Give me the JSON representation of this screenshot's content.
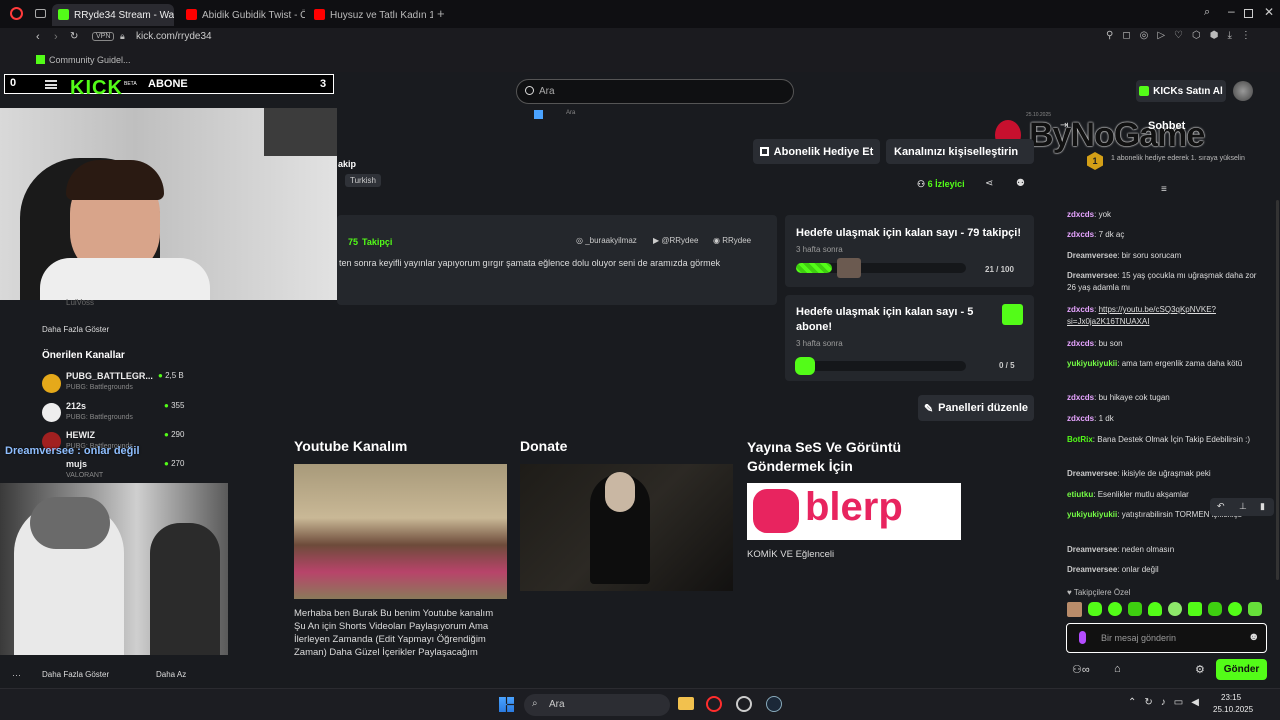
{
  "browser": {
    "tabs": [
      {
        "label": "RRyde34 Stream - Watch",
        "color": "#53fc18"
      },
      {
        "label": "Abidik Gubidik Twist - Öz",
        "color": "#ff0000"
      },
      {
        "label": "Huysuz ve Tatlı Kadın 1. B",
        "color": "#ff0000"
      }
    ],
    "vpn": "VPN",
    "url": "kick.com/rryde34",
    "bookmark": "Community Guidel..."
  },
  "overlay": {
    "left_number": "0",
    "logo": "KICK",
    "beta": "BETA",
    "abone_label": "ABONE",
    "abone_count": "3",
    "brand": "ByNoGame"
  },
  "header": {
    "search_placeholder": "Ara",
    "buy_kicks": "KICKs Satın Al"
  },
  "stream_preview": {
    "search": "Ara",
    "date": "25.10.2025"
  },
  "channel": {
    "follow_partial": "akip",
    "language": "Turkish",
    "gift_sub": "Abonelik Hediye Et",
    "customize": "Kanalınızı kişiselleştirin",
    "viewers_count": "6",
    "viewers_label": "İzleyici",
    "followers_count": "75",
    "followers_label": "Takipçi",
    "socials": [
      "_buraakyilmaz",
      "@RRydee",
      "RRydee"
    ],
    "bio": "ten sonra keyifli yayınlar yapıyorum gırgır şamata eğlence dolu oluyor seni de aramızda görmek"
  },
  "goals": [
    {
      "title": "Hedefe ulaşmak için kalan sayı - 79 takipçi!",
      "time": "3 hafta sonra",
      "progress": "21 / 100",
      "fraction": 0.21
    },
    {
      "title": "Hedefe ulaşmak için kalan sayı - 5 abone!",
      "time": "3 hafta sonra",
      "progress": "0 / 5",
      "fraction": 0
    }
  ],
  "edit_panels": "Panelleri düzenle",
  "panels": [
    {
      "title": "Youtube Kanalım",
      "text": "Merhaba ben Burak Bu benim Youtube kanalım Şu An için Shorts Videoları Paylaşıyorum Ama İlerleyen Zamanda (Edit Yapmayı Öğrendiğim Zaman) Daha Güzel İçerikler Paylaşacağım"
    },
    {
      "title": "Donate",
      "text": ""
    },
    {
      "title": "Yayına SeS Ve Görüntü Göndermek İçin",
      "text": "KOMİK VE Eğlenceli",
      "image_text": "blerp"
    }
  ],
  "sidebar": {
    "partial_user": "LuiVoss",
    "show_more": "Daha Fazla Göster",
    "recommended_title": "Önerilen Kanallar",
    "channels": [
      {
        "name": "PUBG_BATTLEGR...",
        "game": "PUBG: Battlegrounds",
        "viewers": "2,5 B"
      },
      {
        "name": "212s",
        "game": "PUBG: Battlegrounds",
        "viewers": "355"
      },
      {
        "name": "HEWIZ",
        "game": "PUBG: Battlegrounds",
        "viewers": "290"
      },
      {
        "name": "mujs",
        "game": "VALORANT",
        "viewers": "270"
      }
    ],
    "show_more_2": "Daha Fazla Göster",
    "show_less": "Daha Az",
    "overlay_msg": "Dreamversee : onlar değil"
  },
  "chat": {
    "title": "Sohbet",
    "rank_text": "1 abonelik hediye ederek 1. sıraya yükselin",
    "rank_num": "1",
    "messages": [
      {
        "user": "zdxcds",
        "text": "yok",
        "color": "#e6a4ff"
      },
      {
        "user": "zdxcds",
        "text": "7 dk aç",
        "color": "#e6a4ff"
      },
      {
        "user": "Dreamversee",
        "text": "bir soru sorucam",
        "color": "#c9c9c9"
      },
      {
        "user": "Dreamversee",
        "text": "15 yaş çocukla mı uğraşmak daha zor 26 yaş adamla mı",
        "color": "#c9c9c9"
      },
      {
        "user": "zdxcds",
        "text": "https://youtu.be/cSQ3qKpNVKE?si=Jx0ja2K16TNUAXAI",
        "color": "#e6a4ff"
      },
      {
        "user": "zdxcds",
        "text": "bu son",
        "color": "#e6a4ff"
      },
      {
        "user": "yukiyukiyukii",
        "text": "ama tam ergenlik zama daha kötü",
        "color": "#75fd46"
      },
      {
        "user": "zdxcds",
        "text": "bu hikaye cok tugan",
        "color": "#e6a4ff"
      },
      {
        "user": "zdxcds",
        "text": "1 dk",
        "color": "#e6a4ff"
      },
      {
        "user": "BotRix",
        "text": "Bana Destek Olmak İçin Takip Edebilirsin :)",
        "color": "#53fc18"
      },
      {
        "user": "Dreamversee",
        "text": "ikisiyle de uğraşmak peki",
        "color": "#c9c9c9"
      },
      {
        "user": "etiutku",
        "text": "Esenlikler mutlu akşamlar",
        "color": "#75fd46"
      },
      {
        "user": "yukiyukiyukii",
        "text": "yatıştırabilirsin TORMEN işkfskfşs",
        "color": "#75fd46"
      },
      {
        "user": "Dreamversee",
        "text": "neden olmasın",
        "color": "#c9c9c9"
      },
      {
        "user": "Dreamversee",
        "text": "onlar değil",
        "color": "#c9c9c9"
      }
    ],
    "followers_only": "Takipçilere Özel",
    "input_placeholder": "Bir mesaj gönderin",
    "send": "Gönder"
  },
  "taskbar": {
    "search": "Ara",
    "time": "23:15",
    "date": "25.10.2025"
  },
  "colors": {
    "kick_green": "#53fc18",
    "bg": "#191b1f",
    "card": "#24272c"
  }
}
